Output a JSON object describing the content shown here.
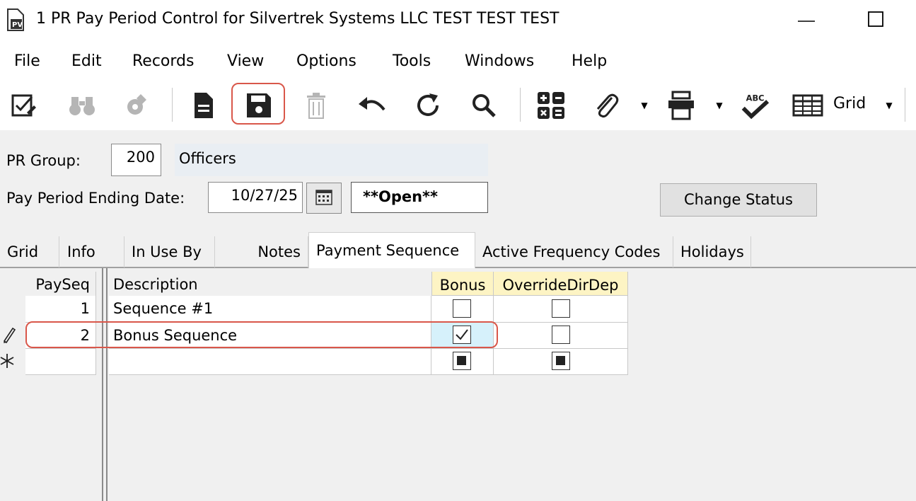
{
  "window": {
    "title": "1 PR Pay Period Control for Silvertrek Systems LLC TEST TEST TEST",
    "app_icon": "pv-document-icon",
    "minimize_icon": "minimize-icon",
    "maximize_icon": "maximize-icon"
  },
  "menu": {
    "items": [
      "File",
      "Edit",
      "Records",
      "View",
      "Options",
      "Tools",
      "Windows",
      "Help"
    ]
  },
  "toolbar": {
    "buttons": [
      {
        "icon": "checklist-edit-icon",
        "enabled": true
      },
      {
        "icon": "binoculars-icon",
        "enabled": false
      },
      {
        "icon": "tools-icon",
        "enabled": false
      },
      {
        "icon": "new-document-icon",
        "enabled": true
      },
      {
        "icon": "save-icon",
        "enabled": true,
        "highlighted": true
      },
      {
        "icon": "trash-icon",
        "enabled": false
      },
      {
        "icon": "undo-icon",
        "enabled": true
      },
      {
        "icon": "refresh-icon",
        "enabled": true
      },
      {
        "icon": "search-icon",
        "enabled": true
      },
      {
        "icon": "calculator-icon",
        "enabled": true
      },
      {
        "icon": "paperclip-icon",
        "enabled": true
      },
      {
        "icon": "printer-icon",
        "enabled": true
      },
      {
        "icon": "spellcheck-icon",
        "enabled": true
      },
      {
        "icon": "grid-icon",
        "enabled": true
      }
    ],
    "grid_label": "Grid",
    "highlight_color": "#d9574a"
  },
  "form": {
    "pr_group_label": "PR Group:",
    "pr_group_value": "200",
    "pr_group_desc": "Officers",
    "date_label": "Pay Period Ending Date:",
    "date_value": "10/27/25",
    "status_value": "**Open**",
    "change_status_label": "Change Status"
  },
  "tabs": {
    "items": [
      "Grid",
      "Info",
      "In Use By",
      "Notes",
      "Payment Sequence",
      "Active Frequency Codes",
      "Holidays"
    ],
    "active": "Payment Sequence"
  },
  "grid": {
    "columns": [
      "PaySeq",
      "Description",
      "Bonus",
      "OverrideDirDep"
    ],
    "rows": [
      {
        "indicator": "",
        "payseq": "1",
        "description": "Sequence #1",
        "bonus": false,
        "override": false
      },
      {
        "indicator": "pencil-icon",
        "payseq": "2",
        "description": "Bonus Sequence",
        "bonus": true,
        "override": false
      },
      {
        "indicator": "asterisk-icon",
        "payseq": "",
        "description": "",
        "bonus": null,
        "override": null
      }
    ],
    "header_highlight_color": "#fdf4c4",
    "selected_cell_color": "#d6f1fb"
  }
}
